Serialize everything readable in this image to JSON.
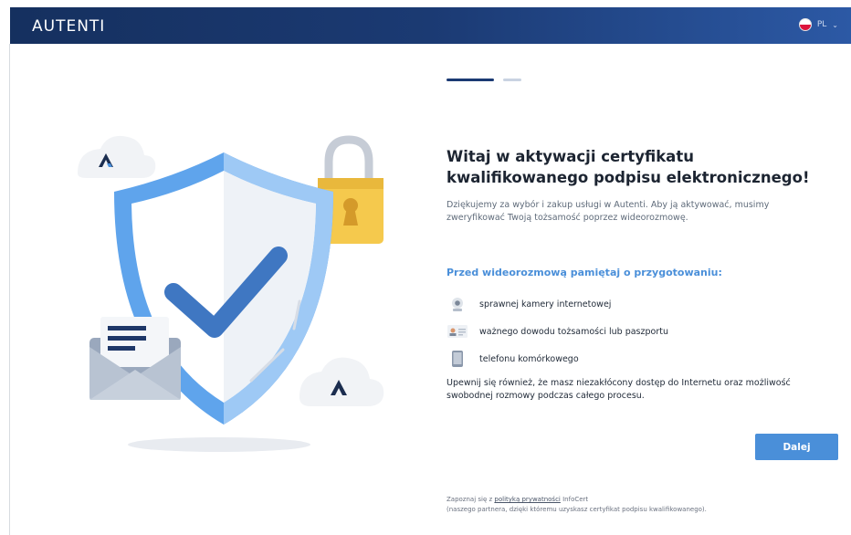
{
  "header": {
    "logo_text": "AUTENTI",
    "language_code": "PL"
  },
  "progress": {
    "current_step": 1,
    "total_steps": 2
  },
  "main": {
    "title": "Witaj w aktywacji certyfikatu kwalifikowanego podpisu elektronicznego!",
    "intro": "Dziękujemy za wybór i zakup usługi w Autenti. Aby ją aktywować, musimy zweryfikować Twoją tożsamość poprzez wideorozmowę.",
    "prep_heading": "Przed wideorozmową pamiętaj o przygotowaniu:",
    "checklist": [
      {
        "icon": "webcam-icon",
        "label": "sprawnej kamery internetowej"
      },
      {
        "icon": "id-card-icon",
        "label": "ważnego dowodu tożsamości lub paszportu"
      },
      {
        "icon": "phone-icon",
        "label": "telefonu komórkowego"
      }
    ],
    "note": "Upewnij się również, że masz niezakłócony dostęp do Internetu oraz możliwość swobodnej rozmowy podczas całego procesu.",
    "next_label": "Dalej"
  },
  "footer": {
    "line1_prefix": "Zapoznaj się z ",
    "privacy_link": "polityką prywatności",
    "line1_suffix": " InfoCert",
    "line2": "(naszego partnera, dzięki któremu uzyskasz certyfikat podpisu kwalifikowanego)."
  },
  "colors": {
    "header_dark": "#15305f",
    "header_light": "#2c59a5",
    "accent": "#4a8fd9",
    "title": "#1c2431"
  }
}
